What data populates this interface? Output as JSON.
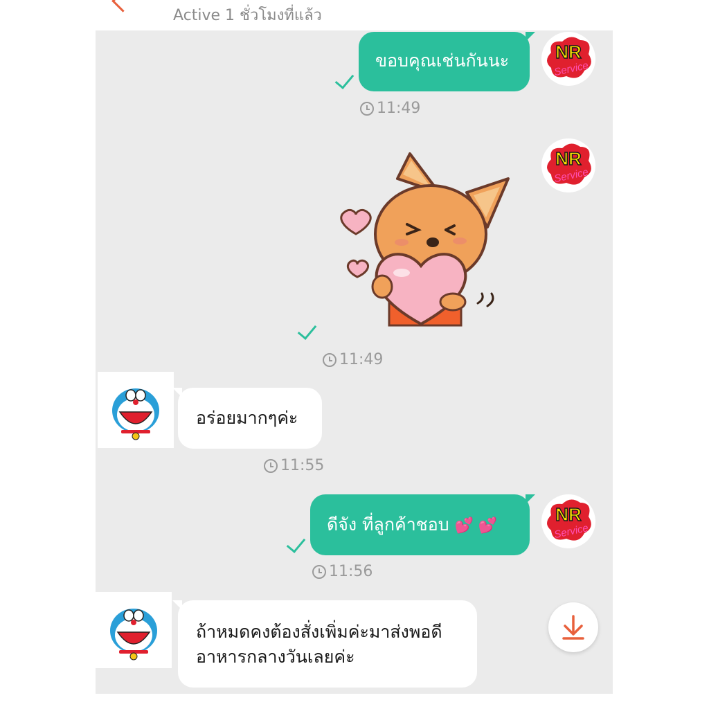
{
  "header": {
    "status_text": "Active 1 ชั่วโมงที่แล้ว"
  },
  "messages": [
    {
      "side": "out",
      "type": "text",
      "text": "ขอบคุณเช่นกันนะ",
      "time": "11:49",
      "read": true
    },
    {
      "side": "out",
      "type": "sticker",
      "sticker": "corgi-holding-heart",
      "time": "11:49",
      "read": true
    },
    {
      "side": "in",
      "type": "text",
      "text": "อร่อยมากๆค่ะ",
      "time": "11:55"
    },
    {
      "side": "out",
      "type": "text",
      "text": "ดีจัง ที่ลูกค้าชอบ",
      "emoji": "💕 💕",
      "time": "11:56",
      "read": true
    },
    {
      "side": "in",
      "type": "text",
      "line1": "ถ้าหมดคงต้องสั่งเพิ่มค่ะมาส่งพอดี",
      "line2": "อาหารกลางวันเลยค่ะ"
    }
  ],
  "sender_avatar": {
    "line1": "NR",
    "line2": "Service"
  },
  "icons": {
    "back": "back-arrow-icon",
    "read": "check-icon",
    "time": "clock-icon",
    "download": "download-icon"
  },
  "colors": {
    "outgoing_bubble": "#2bbf9c",
    "incoming_bubble": "#ffffff",
    "chat_background": "#ebebeb",
    "accent": "#e8603c"
  }
}
